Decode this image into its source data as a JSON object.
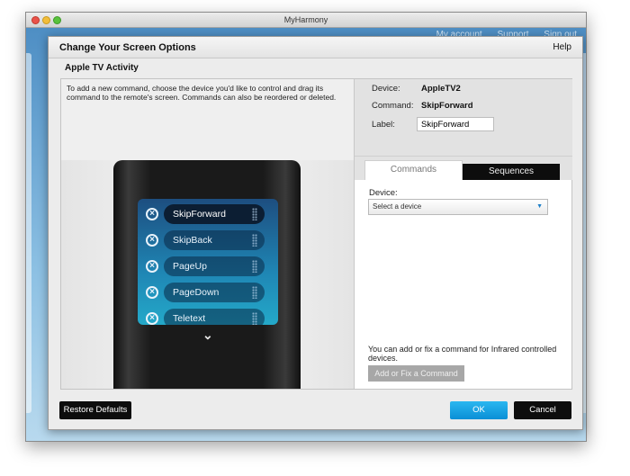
{
  "window": {
    "title": "MyHarmony"
  },
  "background_links": [
    "My account",
    "Support",
    "Sign out"
  ],
  "dialog": {
    "title": "Change Your Screen Options",
    "help_label": "Help",
    "activity_title": "Apple TV Activity",
    "instructions": "To add a new command, choose the device you'd like to control and drag its command to the remote's screen. Commands can also be reordered or deleted."
  },
  "remote": {
    "commands": [
      {
        "label": "SkipForward",
        "active": true
      },
      {
        "label": "SkipBack",
        "active": false
      },
      {
        "label": "PageUp",
        "active": false
      },
      {
        "label": "PageDown",
        "active": false
      },
      {
        "label": "Teletext",
        "active": false
      }
    ]
  },
  "details": {
    "device_label": "Device:",
    "device_value": "AppleTV2",
    "command_label": "Command:",
    "command_value": "SkipForward",
    "label_label": "Label:",
    "label_value": "SkipForward"
  },
  "tabs": [
    {
      "label": "Commands",
      "active": true
    },
    {
      "label": "Sequences",
      "active": false
    }
  ],
  "commands_panel": {
    "device_label": "Device:",
    "select_value": "Select a device",
    "help_text": "You can add or fix a command for Infrared controlled devices.",
    "fix_button": "Add or Fix a Command"
  },
  "footer": {
    "restore_label": "Restore Defaults",
    "ok_label": "OK",
    "cancel_label": "Cancel"
  },
  "colors": {
    "ok_accent": "#0a8fd6",
    "screen_blue": "#1f87b5",
    "dark_button": "#0d0d0d"
  }
}
